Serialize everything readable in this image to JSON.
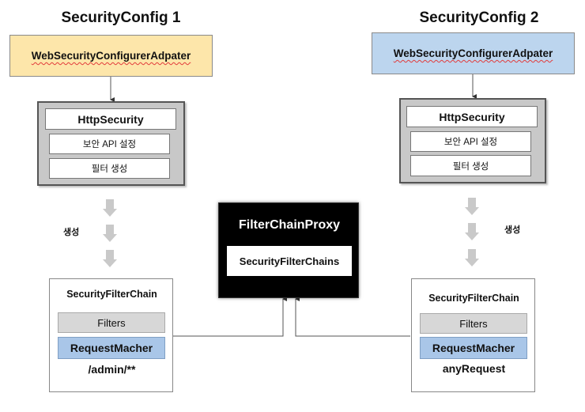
{
  "left": {
    "title": "SecurityConfig 1",
    "adapter": "WebSecurityConfigurerAdpater",
    "http_security": "HttpSecurity",
    "security_api": "보안 API 설정",
    "filter_create": "필터 생성",
    "create_label": "생성",
    "chain_title": "SecurityFilterChain",
    "filters": "Filters",
    "request_matcher": "RequestMacher",
    "matcher_value": "/admin/**"
  },
  "right": {
    "title": "SecurityConfig 2",
    "adapter": "WebSecurityConfigurerAdpater",
    "http_security": "HttpSecurity",
    "security_api": "보안 API 설정",
    "filter_create": "필터 생성",
    "create_label": "생성",
    "chain_title": "SecurityFilterChain",
    "filters": "Filters",
    "request_matcher": "RequestMacher",
    "matcher_value": "anyRequest"
  },
  "proxy": {
    "title": "FilterChainProxy",
    "chains": "SecurityFilterChains"
  },
  "colors": {
    "adapter_left": "#fde6aa",
    "adapter_right": "#bcd5ee",
    "request_matcher": "#a9c6e8",
    "filters_bar": "#d7d7d7",
    "http_box": "#c8c8c8",
    "proxy_bg": "#000000"
  }
}
